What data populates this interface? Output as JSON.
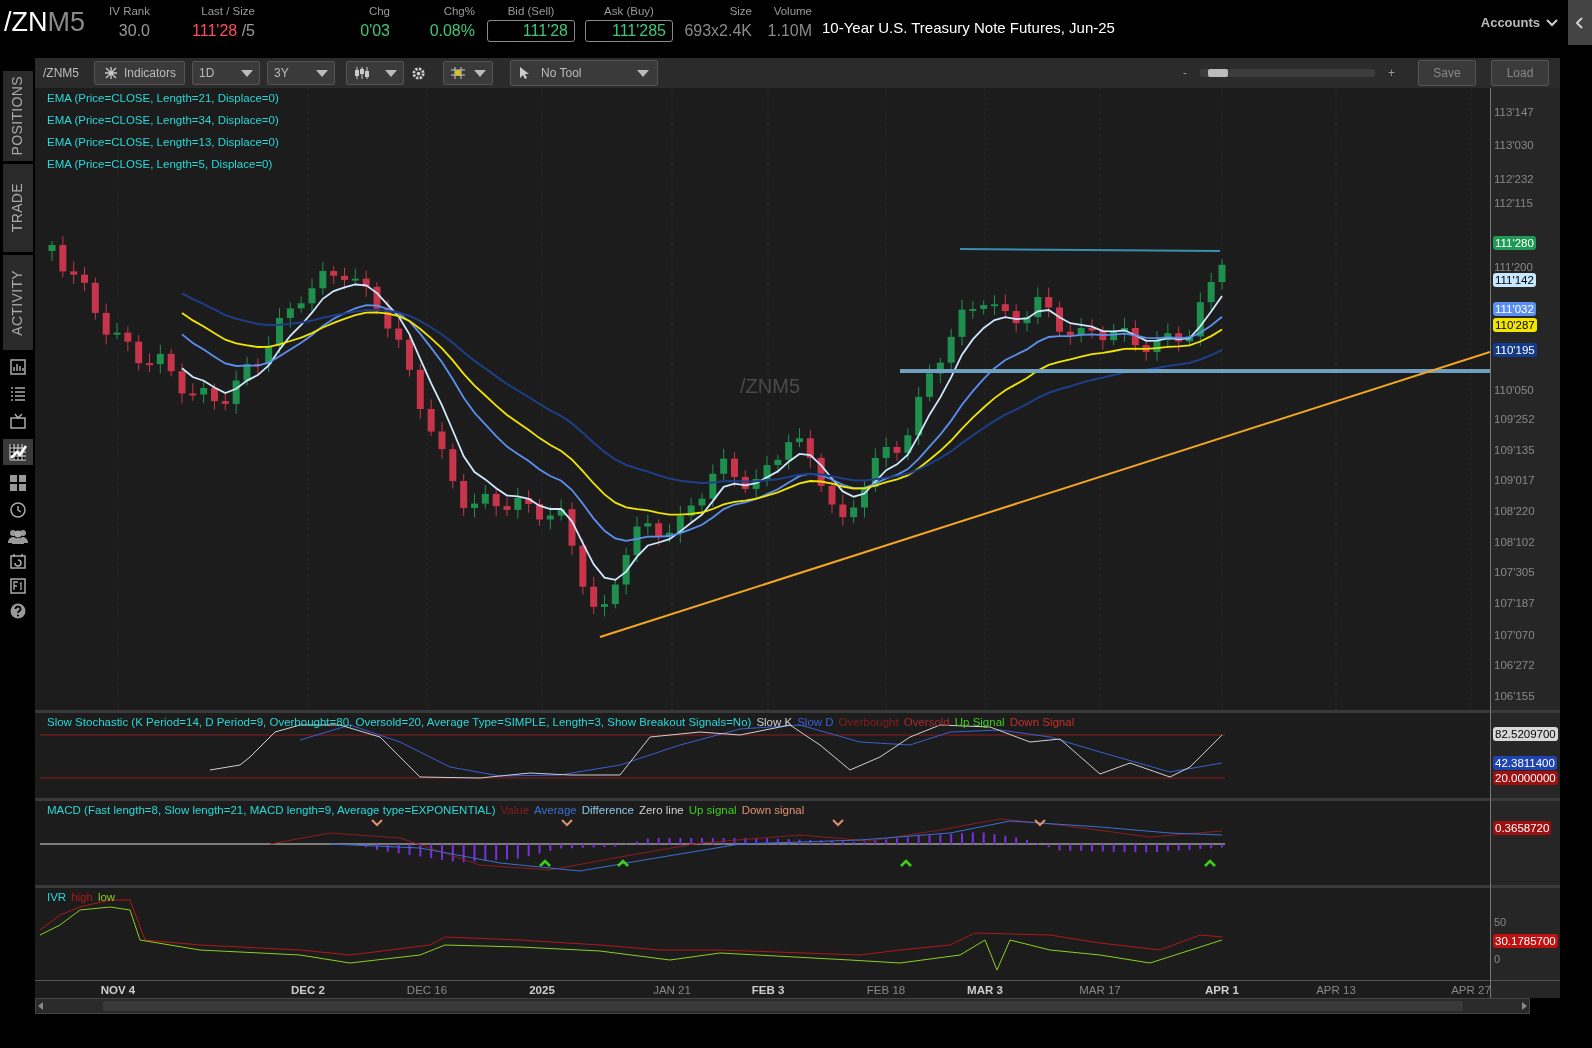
{
  "header": {
    "symbol_main": "/ZN",
    "symbol_suffix": "M5",
    "stats": [
      {
        "label": "IV Rank",
        "value": "30.0",
        "color": "#9a9a9a",
        "boxed": false
      },
      {
        "label": "Last / Size",
        "value": "111'28",
        "suffix": "/5",
        "color": "#ff4d5a",
        "boxed": false
      },
      {
        "label": "Chg",
        "value": "0'03",
        "color": "#3fc77a",
        "boxed": false
      },
      {
        "label": "Chg%",
        "value": "0.08%",
        "color": "#3fc77a",
        "boxed": false
      },
      {
        "label": "Bid (Sell)",
        "value": "111'28",
        "color": "#3fc77a",
        "boxed": true
      },
      {
        "label": "Ask (Buy)",
        "value": "111'285",
        "color": "#3fc77a",
        "boxed": true
      },
      {
        "label": "Size",
        "value": "693x2.4K",
        "color": "#8a8a8a",
        "boxed": false
      },
      {
        "label": "Volume",
        "value": "1.10M",
        "color": "#8a8a8a",
        "boxed": false
      }
    ],
    "description": "10-Year U.S. Treasury Note Futures, Jun-25",
    "accounts": "Accounts"
  },
  "sidebar": {
    "tabs": [
      {
        "label": "POSITIONS"
      },
      {
        "label": "TRADE"
      },
      {
        "label": "ACTIVITY"
      }
    ]
  },
  "toolbar": {
    "symbol": "/ZNM5",
    "indicators": "Indicators",
    "aggregation": "1D",
    "range": "3Y",
    "drawing_tool": "No Tool",
    "zoom_out": "-",
    "zoom_in": "+",
    "zoom_slider": {
      "level": 0.05
    },
    "save": "Save",
    "load": "Load"
  },
  "price_pane": {
    "studies": [
      "EMA (Price=CLOSE, Length=21, Displace=0)",
      "EMA (Price=CLOSE, Length=34, Displace=0)",
      "EMA (Price=CLOSE, Length=13, Displace=0)",
      "EMA (Price=CLOSE, Length=5, Displace=0)"
    ],
    "symbol_label": "/ZNM5",
    "y_ticks": [
      "113'147",
      "113'030",
      "112'232",
      "112'115",
      "111'200",
      "110'050",
      "109'252",
      "109'135",
      "109'017",
      "108'220",
      "108'102",
      "107'305",
      "107'187",
      "107'070",
      "106'272",
      "106'155"
    ],
    "badges": [
      {
        "value": "111'280",
        "color": "#1f9a55"
      },
      {
        "value": "111'142",
        "color": "#c8e8ff"
      },
      {
        "value": "111'032",
        "color": "#5b8ff0"
      },
      {
        "value": "110'287",
        "color": "#f2e600"
      },
      {
        "value": "110'195",
        "color": "#143a8c"
      }
    ]
  },
  "stochastic_pane": {
    "title": "Slow Stochastic (K Period=14, D Period=9, Overbought=80, Oversold=20, Average Type=SIMPLE, Length=3, Show Breakout Signals=No)",
    "legend": [
      {
        "label": "Slow K",
        "color": "#d0d0d0"
      },
      {
        "label": "Slow D",
        "color": "#3a5fd0"
      },
      {
        "label": "Overbought",
        "color": "#8a1d1d"
      },
      {
        "label": "Oversold",
        "color": "#a82a2a"
      },
      {
        "label": "Up Signal",
        "color": "#3fd01a"
      },
      {
        "label": "Down Signal",
        "color": "#c0302a"
      }
    ],
    "badges": [
      {
        "value": "82.5209700",
        "color": "#d8d8d8"
      },
      {
        "value": "42.3811400",
        "color": "#1f44b0"
      },
      {
        "value": "20.0000000",
        "color": "#9e1010"
      }
    ]
  },
  "macd_pane": {
    "title": "MACD (Fast length=8, Slow length=21, MACD length=9, Average type=EXPONENTIAL)",
    "legend": [
      {
        "label": "Value",
        "color": "#8a1d1d"
      },
      {
        "label": "Average",
        "color": "#3a6fd0"
      },
      {
        "label": "Difference",
        "color": "#8fc8e8"
      },
      {
        "label": "Zero line",
        "color": "#d0d0d0"
      },
      {
        "label": "Up signal",
        "color": "#3fd01a"
      },
      {
        "label": "Down signal",
        "color": "#e09070"
      }
    ],
    "badges": [
      {
        "value": "0.3658720",
        "color": "#9e1010"
      }
    ]
  },
  "ivr_pane": {
    "title": "IVR",
    "legend": [
      {
        "label": "high",
        "color": "#b01818"
      },
      {
        "label": "low",
        "color": "#8ad020"
      }
    ],
    "y_ticks": [
      "50",
      "0"
    ],
    "badges": [
      {
        "value": "30.1785700",
        "color": "#c01010"
      }
    ]
  },
  "x_axis": [
    {
      "label": "NOV 4",
      "bold": true
    },
    {
      "label": "DEC 2",
      "bold": true
    },
    {
      "label": "DEC 16",
      "bold": false
    },
    {
      "label": "2025",
      "bold": true
    },
    {
      "label": "JAN 21",
      "bold": false
    },
    {
      "label": "FEB 3",
      "bold": true
    },
    {
      "label": "FEB 18",
      "bold": false
    },
    {
      "label": "MAR 3",
      "bold": true
    },
    {
      "label": "MAR 17",
      "bold": false
    },
    {
      "label": "APR 1",
      "bold": true
    },
    {
      "label": "APR 13",
      "bold": false
    },
    {
      "label": "APR 27",
      "bold": false
    }
  ]
}
